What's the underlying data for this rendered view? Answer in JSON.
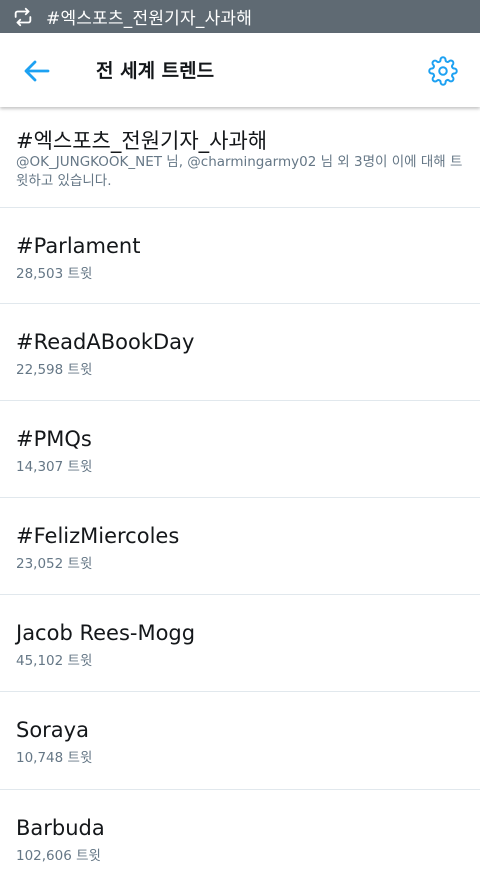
{
  "status_bar": {
    "icon": "retweet-icon",
    "text": "#엑스포츠_전원기자_사과해"
  },
  "header": {
    "back_icon": "arrow-left-icon",
    "title": "전 세계 트렌드",
    "settings_icon": "gear-icon",
    "accent_color": "#1da1f2"
  },
  "trends": [
    {
      "name": "#엑스포츠_전원기자_사과해",
      "description": "@OK_JUNGKOOK_NET 님, @charmingarmy02 님 외 3명이 이에 대해 트윗하고 있습니다."
    },
    {
      "name": "#Parlament",
      "count": "28,503 트윗"
    },
    {
      "name": "#ReadABookDay",
      "count": "22,598 트윗"
    },
    {
      "name": "#PMQs",
      "count": "14,307 트윗"
    },
    {
      "name": "#FelizMiercoles",
      "count": "23,052 트윗"
    },
    {
      "name": "Jacob Rees-Mogg",
      "count": "45,102 트윗"
    },
    {
      "name": "Soraya",
      "count": "10,748 트윗"
    },
    {
      "name": "Barbuda",
      "count": "102,606 트윗"
    }
  ]
}
